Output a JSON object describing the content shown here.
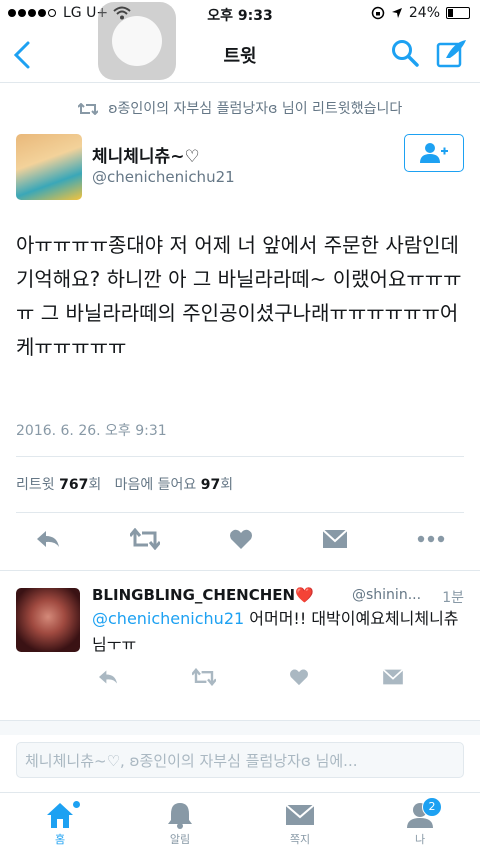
{
  "status_bar": {
    "carrier": "LG U+",
    "time": "오후 9:33",
    "battery": "24%"
  },
  "nav": {
    "title": "트윗"
  },
  "retweet_context": "ʚ종인이의 자부심 플럼낭자ɞ 님이 리트윗했습니다",
  "tweet": {
    "author_name": "체니체니츄~♡",
    "author_handle": "@chenichenichu21",
    "text": "아ㅠㅠㅠㅠ종대야 저 어제 너 앞에서 주문한 사람인데 기억해요? 하니깐 아 그 바닐라라떼~ 이랬어요ㅠㅠㅠㅠ 그 바닐라라떼의 주인공이셨구나래ㅠㅠㅠㅠㅠㅠ어케ㅠㅠㅠㅠㅠ",
    "timestamp": "2016. 6. 26. 오후 9:31",
    "retweets_label": "리트윗",
    "retweets_count": "767",
    "retweets_unit": "회",
    "likes_label": "마음에 들어요",
    "likes_count": "97",
    "likes_unit": "회"
  },
  "reply": {
    "author_name": "BLINGBLING_CHENCHEN❤️",
    "author_handle": "@shinin...",
    "time": "1분",
    "mention": "@chenichenichu21",
    "text": " 어머머!! 대박이예요체니체니츄님ㅜㅠ"
  },
  "compose_placeholder": "체니체니츄~♡, ʚ종인이의 자부심 플럼낭자ɞ 님에...",
  "tabs": [
    {
      "label": "홈",
      "icon": "home-icon"
    },
    {
      "label": "알림",
      "icon": "bell-icon"
    },
    {
      "label": "쪽지",
      "icon": "envelope-icon"
    },
    {
      "label": "나",
      "icon": "person-icon",
      "badge": "2"
    }
  ],
  "colors": {
    "accent": "#1da1f2",
    "muted": "#8899a6"
  }
}
